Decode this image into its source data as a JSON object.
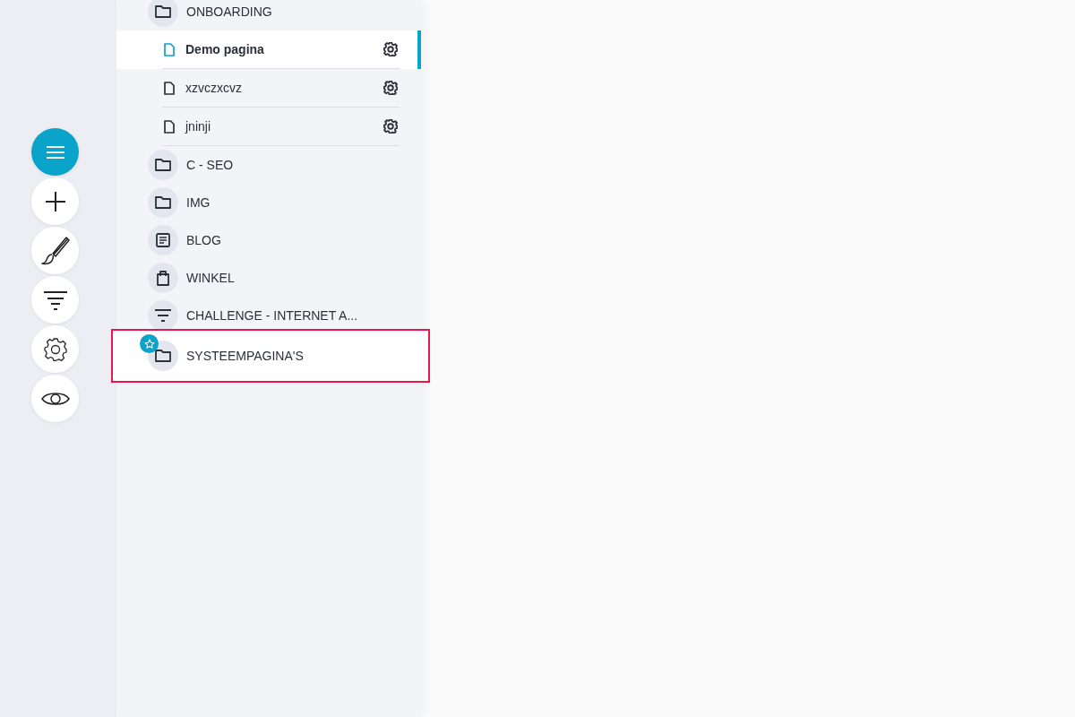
{
  "toolbar": [
    {
      "kind": "menu",
      "selected": true
    },
    {
      "kind": "add",
      "selected": false
    },
    {
      "kind": "brush",
      "selected": false
    },
    {
      "kind": "filter",
      "selected": false
    },
    {
      "kind": "settings",
      "selected": false
    },
    {
      "kind": "preview",
      "selected": false
    }
  ],
  "tree": [
    {
      "label": "ONBOARDING",
      "kind": "folder",
      "starred": false,
      "highlighted": false,
      "children": [
        {
          "label": "Demo pagina",
          "selected": true
        },
        {
          "label": "xzvczxcvz",
          "selected": false
        },
        {
          "label": "jninji",
          "selected": false
        }
      ]
    },
    {
      "label": "C - SEO",
      "kind": "folder",
      "starred": false,
      "highlighted": false
    },
    {
      "label": "IMG",
      "kind": "folder",
      "starred": false,
      "highlighted": false
    },
    {
      "label": "BLOG",
      "kind": "blog",
      "starred": false,
      "highlighted": false
    },
    {
      "label": "WINKEL",
      "kind": "shop",
      "starred": false,
      "highlighted": false
    },
    {
      "label": "CHALLENGE - INTERNET A...",
      "kind": "filter",
      "starred": false,
      "highlighted": false
    },
    {
      "label": "SYSTEEMPAGINA'S",
      "kind": "folder",
      "starred": true,
      "highlighted": true
    }
  ]
}
